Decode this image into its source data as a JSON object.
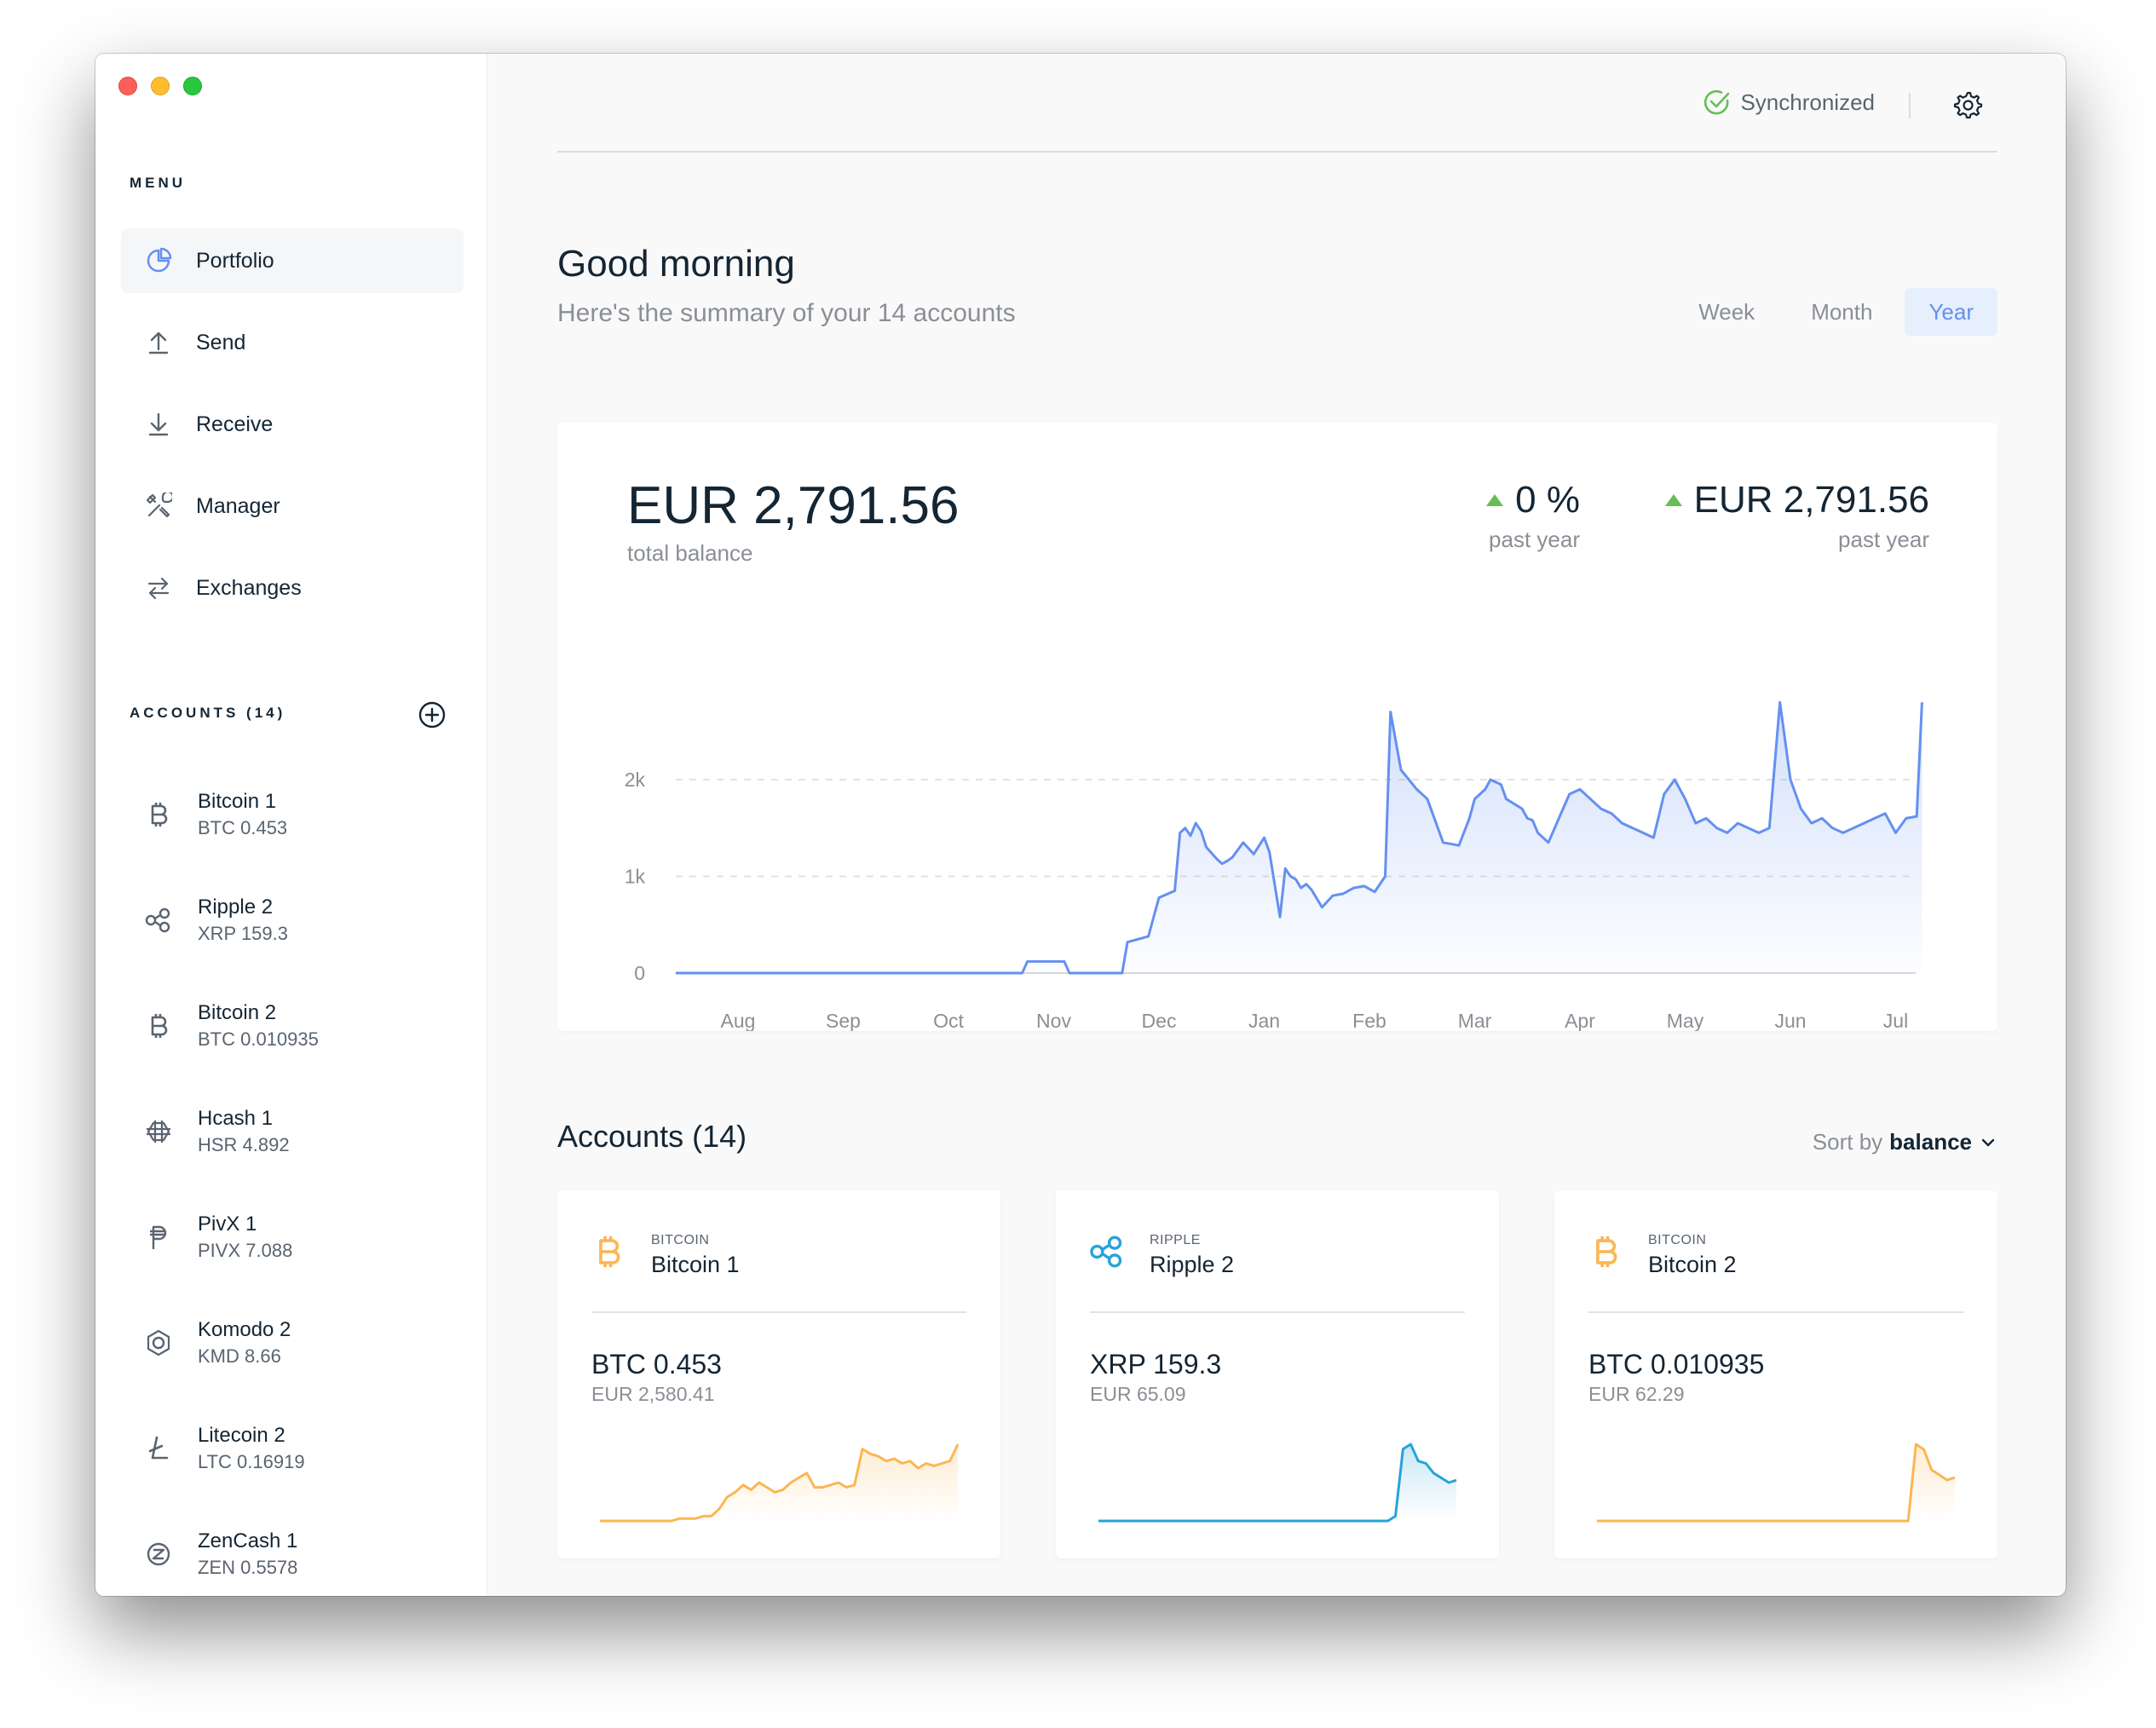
{
  "window": {
    "title": ""
  },
  "menu": {
    "heading": "MENU",
    "items": [
      {
        "label": "Portfolio",
        "icon": "pie-chart-icon",
        "active": true
      },
      {
        "label": "Send",
        "icon": "upload-arrow-icon",
        "active": false
      },
      {
        "label": "Receive",
        "icon": "download-arrow-icon",
        "active": false
      },
      {
        "label": "Manager",
        "icon": "tools-icon",
        "active": false
      },
      {
        "label": "Exchanges",
        "icon": "swap-arrows-icon",
        "active": false
      }
    ]
  },
  "accounts_sidebar": {
    "heading": "ACCOUNTS (14)",
    "items": [
      {
        "name": "Bitcoin 1",
        "balance": "BTC 0.453",
        "icon": "bitcoin-icon"
      },
      {
        "name": "Ripple 2",
        "balance": "XRP 159.3",
        "icon": "ripple-icon"
      },
      {
        "name": "Bitcoin 2",
        "balance": "BTC 0.010935",
        "icon": "bitcoin-icon"
      },
      {
        "name": "Hcash 1",
        "balance": "HSR 4.892",
        "icon": "hcash-icon"
      },
      {
        "name": "PivX 1",
        "balance": "PIVX 7.088",
        "icon": "pivx-icon"
      },
      {
        "name": "Komodo 2",
        "balance": "KMD 8.66",
        "icon": "komodo-icon"
      },
      {
        "name": "Litecoin 2",
        "balance": "LTC 0.16919",
        "icon": "litecoin-icon"
      },
      {
        "name": "ZenCash 1",
        "balance": "ZEN 0.5578",
        "icon": "zencash-icon"
      }
    ]
  },
  "topbar": {
    "sync_label": "Synchronized"
  },
  "header": {
    "greeting": "Good morning",
    "summary": "Here's the summary of your 14 accounts",
    "ranges": [
      {
        "label": "Week",
        "active": false
      },
      {
        "label": "Month",
        "active": false
      },
      {
        "label": "Year",
        "active": true
      }
    ]
  },
  "balance": {
    "total": "EUR 2,791.56",
    "total_label": "total balance",
    "pct_change": "0 %",
    "pct_label": "past year",
    "abs_change": "EUR 2,791.56",
    "abs_label": "past year"
  },
  "colors": {
    "accent": "#6490f1",
    "positive": "#66be54",
    "bitcoin": "#fcb653",
    "ripple": "#27a2db"
  },
  "chart_data": {
    "type": "area",
    "title": "",
    "xlabel": "",
    "ylabel": "",
    "ylim": [
      0,
      2800
    ],
    "yticks": [
      {
        "value": 0,
        "label": "0"
      },
      {
        "value": 1000,
        "label": "1k"
      },
      {
        "value": 2000,
        "label": "2k"
      }
    ],
    "months": [
      "Aug",
      "Sep",
      "Oct",
      "Nov",
      "Dec",
      "Jan",
      "Feb",
      "Mar",
      "Apr",
      "May",
      "Jun",
      "Jul"
    ],
    "grid": "dashed horizontal at 1k and 2k",
    "series": [
      {
        "x_month_index": [
          -0.7,
          2.7,
          2.75,
          3.1,
          3.15,
          3.65,
          3.7,
          3.9,
          4.0,
          4.15,
          4.2,
          4.25,
          4.3,
          4.35,
          4.4,
          4.45,
          4.55,
          4.6,
          4.65,
          4.7,
          4.8,
          4.9,
          5.0,
          5.05,
          5.15,
          5.2,
          5.25,
          5.3,
          5.35,
          5.4,
          5.45,
          5.55,
          5.65,
          5.75,
          5.85,
          5.95,
          6.05,
          6.15,
          6.2,
          6.3,
          6.45,
          6.55,
          6.7,
          6.85,
          6.95,
          7.0,
          7.05,
          7.1,
          7.15,
          7.25,
          7.3,
          7.45,
          7.5,
          7.55,
          7.6,
          7.65,
          7.7,
          7.8,
          7.9,
          8.0,
          8.1,
          8.2,
          8.3,
          8.4,
          8.5,
          8.6,
          8.7,
          8.8,
          8.9,
          9.0,
          9.1,
          9.2,
          9.3,
          9.4,
          9.5,
          9.6,
          9.7,
          9.8,
          9.9,
          10.0,
          10.05,
          10.1,
          10.2,
          10.3,
          10.4,
          10.5,
          10.6,
          10.7,
          10.8,
          10.9,
          11.0,
          11.1,
          11.2,
          11.25
        ],
        "y": [
          0,
          0,
          120,
          120,
          0,
          0,
          320,
          380,
          780,
          850,
          1450,
          1500,
          1420,
          1550,
          1470,
          1300,
          1180,
          1130,
          1160,
          1200,
          1350,
          1230,
          1400,
          1250,
          580,
          1080,
          1000,
          970,
          880,
          920,
          860,
          680,
          800,
          820,
          880,
          900,
          840,
          1000,
          2700,
          2100,
          1900,
          1800,
          1350,
          1320,
          1600,
          1800,
          1850,
          1900,
          2000,
          1950,
          1800,
          1700,
          1600,
          1580,
          1450,
          1400,
          1350,
          1600,
          1850,
          1900,
          1800,
          1700,
          1650,
          1550,
          1500,
          1450,
          1400,
          1850,
          2000,
          1800,
          1550,
          1600,
          1500,
          1450,
          1550,
          1500,
          1450,
          1500,
          2800,
          2000,
          1850,
          1700,
          1550,
          1600,
          1500,
          1450,
          1500,
          1550,
          1600,
          1650,
          1450,
          1600,
          1620,
          2800
        ]
      }
    ]
  },
  "accounts_section": {
    "title": "Accounts (14)",
    "sort_label": "Sort by",
    "sort_value": "balance"
  },
  "account_cards": [
    {
      "currency": "BITCOIN",
      "name": "Bitcoin 1",
      "balance": "BTC 0.453",
      "fiat": "EUR 2,580.41",
      "icon": "bitcoin-icon",
      "spark": [
        0,
        0,
        0,
        0,
        0,
        0,
        0,
        0,
        0,
        0,
        1,
        1,
        1,
        2,
        2,
        5,
        10,
        12,
        15,
        13,
        16,
        14,
        12,
        13,
        16,
        18,
        20,
        14,
        14,
        15,
        16,
        14,
        15,
        30,
        28,
        27,
        25,
        26,
        24,
        25,
        22,
        24,
        23,
        24,
        25,
        32
      ]
    },
    {
      "currency": "RIPPLE",
      "name": "Ripple 2",
      "balance": "XRP 159.3",
      "fiat": "EUR 65.09",
      "icon": "ripple-icon",
      "spark": [
        0,
        0,
        0,
        0,
        0,
        0,
        0,
        0,
        0,
        0,
        0,
        0,
        0,
        0,
        0,
        0,
        0,
        0,
        0,
        0,
        0,
        0,
        0,
        0,
        0,
        0,
        0,
        0,
        0,
        0,
        0,
        0,
        0,
        0,
        0,
        0,
        0,
        0,
        0,
        2,
        30,
        32,
        25,
        24,
        20,
        18,
        16,
        17
      ]
    },
    {
      "currency": "BITCOIN",
      "name": "Bitcoin 2",
      "balance": "BTC 0.010935",
      "fiat": "EUR 62.29",
      "icon": "bitcoin-icon",
      "spark": [
        0,
        0,
        0,
        0,
        0,
        0,
        0,
        0,
        0,
        0,
        0,
        0,
        0,
        0,
        0,
        0,
        0,
        0,
        0,
        0,
        0,
        0,
        0,
        0,
        0,
        0,
        0,
        0,
        0,
        0,
        0,
        0,
        0,
        0,
        0,
        0,
        0,
        0,
        0,
        0,
        0,
        30,
        28,
        20,
        18,
        16,
        17
      ]
    }
  ]
}
